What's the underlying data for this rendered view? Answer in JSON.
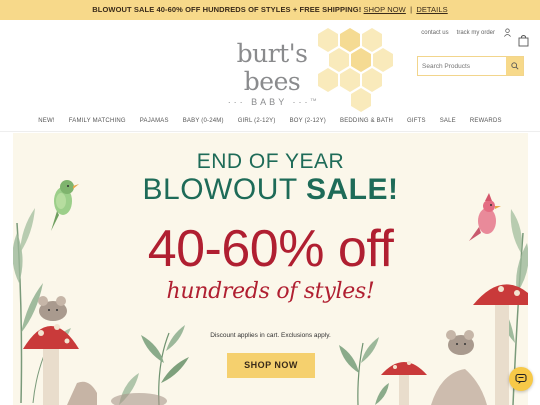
{
  "promo": {
    "text": "BLOWOUT SALE 40-60% OFF HUNDREDS OF STYLES + FREE SHIPPING!",
    "shop_now": "SHOP NOW",
    "separator": "|",
    "details": "DETAILS"
  },
  "brand": {
    "logo_main": "burt's bees",
    "logo_sub": "··· BABY ···",
    "logo_tm": "TM"
  },
  "top_links": {
    "contact": "contact us",
    "track": "track my order"
  },
  "search": {
    "placeholder": "Search Products"
  },
  "nav": {
    "items": [
      "NEW!",
      "FAMILY MATCHING",
      "PAJAMAS",
      "BABY (0-24M)",
      "GIRL (2-12Y)",
      "BOY (2-12Y)",
      "BEDDING & BATH",
      "GIFTS",
      "SALE",
      "REWARDS"
    ]
  },
  "hero": {
    "line1": "END OF YEAR",
    "line2_a": "BLOWOUT ",
    "line2_b": "SALE!",
    "line3": "40-60% off",
    "line4": "hundreds of styles!",
    "note": "Discount applies in cart. Exclusions apply.",
    "cta": "SHOP NOW"
  },
  "colors": {
    "promo_bg": "#f7d98a",
    "heading_green": "#1e6b58",
    "sale_red": "#b01f31",
    "cta_yellow": "#f5d06e",
    "hero_bg": "#fbf7ea"
  },
  "icons": [
    "user-icon",
    "shopping-bag-icon",
    "search-icon",
    "chat-icon"
  ]
}
